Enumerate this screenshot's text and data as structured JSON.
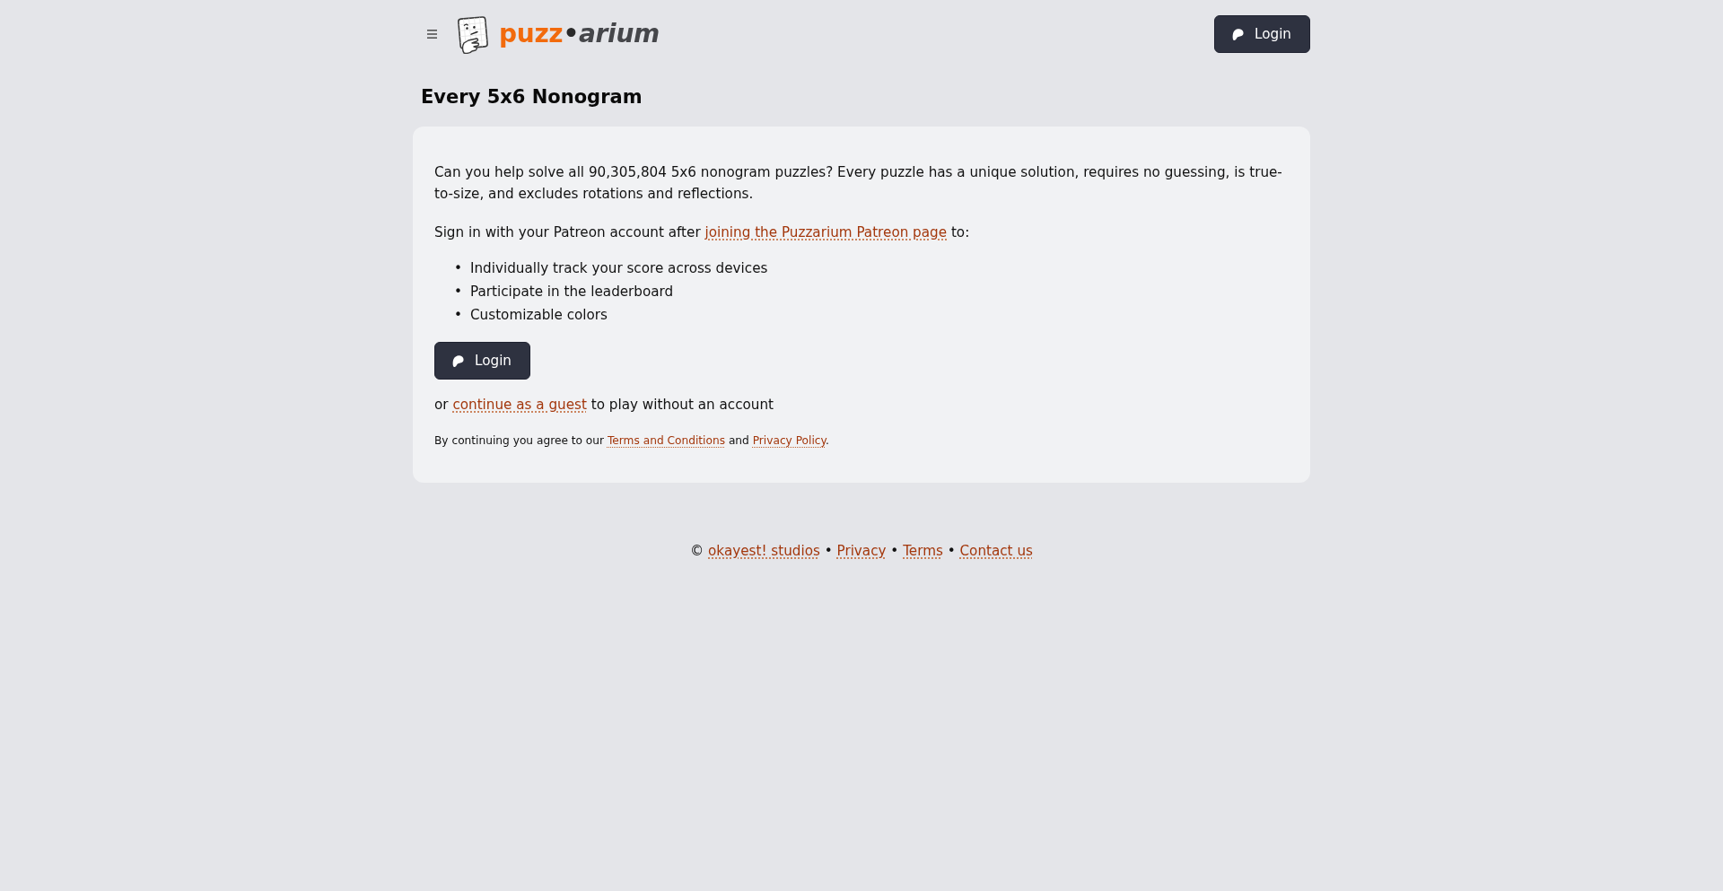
{
  "header": {
    "logo": {
      "accent": "puzz",
      "separator": "•",
      "rest": "arium"
    },
    "login_button": {
      "label": "Login"
    }
  },
  "page_title": "Every 5x6 Nonogram",
  "card": {
    "paragraphs": [
      [
        {
          "kind": "text",
          "text": "Can you help solve all 90,305,804 5x6 nonogram puzzles? Every puzzle has a unique solution, requires no guessing, is true-to-size, and excludes rotations and reflections."
        }
      ],
      [
        {
          "kind": "text",
          "text": "Sign in with your Patreon account after "
        },
        {
          "kind": "link",
          "text": "joining the Puzzarium Patreon page"
        },
        {
          "kind": "text",
          "text": " to:"
        }
      ]
    ],
    "features": [
      {
        "marker": "•",
        "text": "Individually track your score across devices"
      },
      {
        "marker": "•",
        "text": "Participate in the leaderboard"
      },
      {
        "marker": "•",
        "text": "Customizable colors"
      }
    ],
    "login_button": {
      "label": "Login"
    },
    "guest_line": [
      {
        "kind": "text",
        "text": "or "
      },
      {
        "kind": "link",
        "text": "continue as a guest"
      },
      {
        "kind": "text",
        "text": " to play without an account"
      }
    ],
    "legal_note": [
      {
        "kind": "text",
        "text": "By continuing you agree to our "
      },
      {
        "kind": "link",
        "text": "Terms and Conditions"
      },
      {
        "kind": "text",
        "text": " and "
      },
      {
        "kind": "link",
        "text": "Privacy Policy"
      },
      {
        "kind": "text",
        "text": "."
      }
    ]
  },
  "footer": [
    {
      "kind": "text",
      "text": "© "
    },
    {
      "kind": "link",
      "text": "okayest! studios"
    },
    {
      "kind": "text",
      "text": " • "
    },
    {
      "kind": "link",
      "text": "Privacy"
    },
    {
      "kind": "text",
      "text": " • "
    },
    {
      "kind": "link",
      "text": "Terms"
    },
    {
      "kind": "text",
      "text": " • "
    },
    {
      "kind": "link",
      "text": "Contact us"
    }
  ]
}
